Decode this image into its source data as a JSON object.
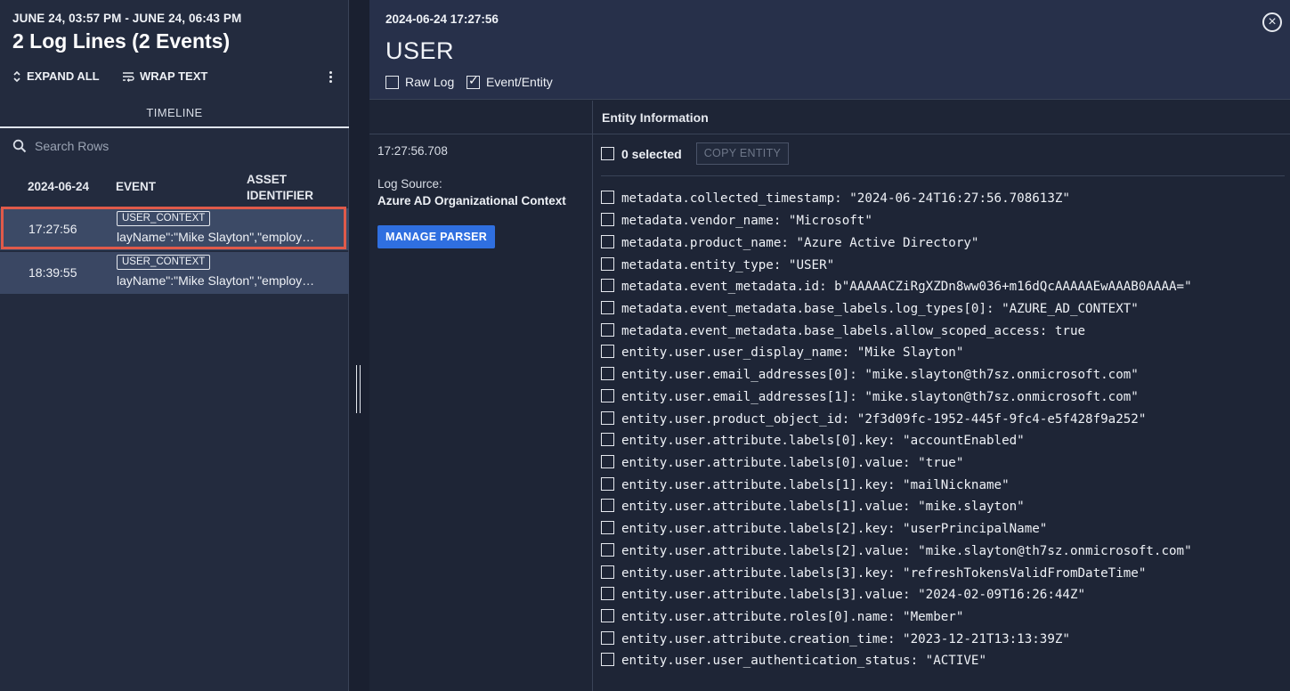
{
  "left": {
    "range": "JUNE 24, 03:57 PM - JUNE 24, 06:43 PM",
    "title": "2 Log Lines (2 Events)",
    "toolbar": {
      "expand_all": "EXPAND ALL",
      "wrap_text": "WRAP TEXT"
    },
    "tab": "TIMELINE",
    "search_placeholder": "Search Rows",
    "columns": {
      "date": "2024-06-24",
      "event": "EVENT",
      "asset": "ASSET IDENTIFIER"
    },
    "rows": [
      {
        "time": "17:27:56",
        "badge": "USER_CONTEXT",
        "snippet": "layName\":\"Mike Slayton\",\"employ…"
      },
      {
        "time": "18:39:55",
        "badge": "USER_CONTEXT",
        "snippet": "layName\":\"Mike Slayton\",\"employ…"
      }
    ]
  },
  "detail": {
    "timestamp": "2024-06-24 17:27:56",
    "type": "USER",
    "raw_log_label": "Raw Log",
    "event_entity_label": "Event/Entity",
    "entity_header": "Entity Information",
    "log_time": "17:27:56.708",
    "log_source_label": "Log Source:",
    "log_source": "Azure AD Organizational Context",
    "manage_parser": "MANAGE PARSER",
    "selected": "0 selected",
    "copy_entity": "COPY ENTITY",
    "fields": [
      "metadata.collected_timestamp: \"2024-06-24T16:27:56.708613Z\"",
      "metadata.vendor_name: \"Microsoft\"",
      "metadata.product_name: \"Azure Active Directory\"",
      "metadata.entity_type: \"USER\"",
      "metadata.event_metadata.id: b\"AAAAACZiRgXZDn8ww036+m16dQcAAAAAEwAAAB0AAAA=\"",
      "metadata.event_metadata.base_labels.log_types[0]: \"AZURE_AD_CONTEXT\"",
      "metadata.event_metadata.base_labels.allow_scoped_access: true",
      "entity.user.user_display_name: \"Mike Slayton\"",
      "entity.user.email_addresses[0]: \"mike.slayton@th7sz.onmicrosoft.com\"",
      "entity.user.email_addresses[1]: \"mike.slayton@th7sz.onmicrosoft.com\"",
      "entity.user.product_object_id: \"2f3d09fc-1952-445f-9fc4-e5f428f9a252\"",
      "entity.user.attribute.labels[0].key: \"accountEnabled\"",
      "entity.user.attribute.labels[0].value: \"true\"",
      "entity.user.attribute.labels[1].key: \"mailNickname\"",
      "entity.user.attribute.labels[1].value: \"mike.slayton\"",
      "entity.user.attribute.labels[2].key: \"userPrincipalName\"",
      "entity.user.attribute.labels[2].value: \"mike.slayton@th7sz.onmicrosoft.com\"",
      "entity.user.attribute.labels[3].key: \"refreshTokensValidFromDateTime\"",
      "entity.user.attribute.labels[3].value: \"2024-02-09T16:26:44Z\"",
      "entity.user.attribute.roles[0].name: \"Member\"",
      "entity.user.attribute.creation_time: \"2023-12-21T13:13:39Z\"",
      "entity.user.user_authentication_status: \"ACTIVE\""
    ]
  }
}
